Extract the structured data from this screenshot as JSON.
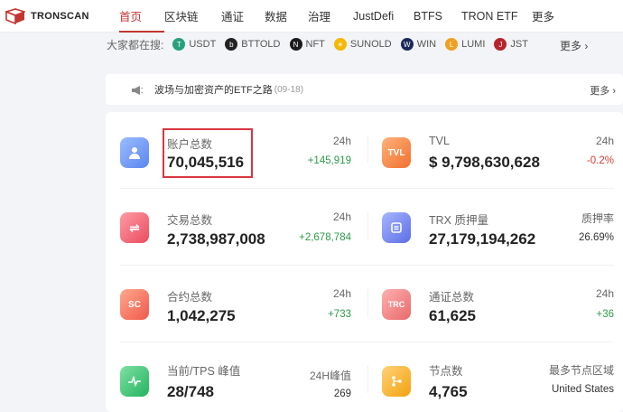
{
  "brand": {
    "name": "TRONSCAN",
    "color": "#c23631"
  },
  "nav": {
    "items": [
      {
        "label": "首页",
        "active": true
      },
      {
        "label": "区块链",
        "active": false
      },
      {
        "label": "通证",
        "active": false
      },
      {
        "label": "数据",
        "active": false
      },
      {
        "label": "治理",
        "active": false
      },
      {
        "label": "JustDefi",
        "active": false
      },
      {
        "label": "BTFS",
        "active": false
      },
      {
        "label": "TRON ETF",
        "active": false
      },
      {
        "label": "更多",
        "active": false
      }
    ]
  },
  "hot_search": {
    "label": "大家都在搜:",
    "tokens": [
      {
        "name": "USDT",
        "icon": "usdt-icon",
        "color": "#26a17b"
      },
      {
        "name": "BTTOLD",
        "icon": "bttold-icon",
        "color": "#222222"
      },
      {
        "name": "NFT",
        "icon": "nft-icon",
        "color": "#1b1b1b"
      },
      {
        "name": "SUNOLD",
        "icon": "sunold-icon",
        "color": "#f5b800"
      },
      {
        "name": "WIN",
        "icon": "win-icon",
        "color": "#1a2a5c"
      },
      {
        "name": "LUMI",
        "icon": "lumi-icon",
        "color": "#f0a020"
      },
      {
        "name": "JST",
        "icon": "jst-icon",
        "color": "#b8242b"
      }
    ],
    "more": "更多 ›"
  },
  "notice": {
    "text": "波场与加密资产的ETF之路",
    "date": "(09-18)",
    "more": "更多 ›"
  },
  "stats": [
    {
      "id": "accounts",
      "label": "账户总数",
      "value": "70,045,516",
      "sub_label": "24h",
      "sub_value": "+145,919",
      "trend": "pos",
      "icon": "accounts-icon",
      "icon_text": "",
      "color": "#6f9cf5"
    },
    {
      "id": "tvl",
      "label": "TVL",
      "value": "$ 9,798,630,628",
      "sub_label": "24h",
      "sub_value": "-0.2%",
      "trend": "neg",
      "icon": "tvl-icon",
      "icon_text": "TVL",
      "color": "#f7924a"
    },
    {
      "id": "transactions",
      "label": "交易总数",
      "value": "2,738,987,008",
      "sub_label": "24h",
      "sub_value": "+2,678,784",
      "trend": "pos",
      "icon": "transactions-icon",
      "icon_text": "⇌",
      "color": "#f26b7a"
    },
    {
      "id": "trx-staked",
      "label": "TRX 质押量",
      "value": "27,179,194,262",
      "sub_label": "质押率",
      "sub_value": "26.69%",
      "trend": "neutral",
      "icon": "staking-icon",
      "icon_text": "",
      "color": "#7a8cf0"
    },
    {
      "id": "contracts",
      "label": "合约总数",
      "value": "1,042,275",
      "sub_label": "24h",
      "sub_value": "+733",
      "trend": "pos",
      "icon": "contracts-icon",
      "icon_text": "SC",
      "color": "#f7826a"
    },
    {
      "id": "tokens",
      "label": "通证总数",
      "value": "61,625",
      "sub_label": "24h",
      "sub_value": "+36",
      "trend": "pos",
      "icon": "tokens-icon",
      "icon_text": "TRC",
      "color": "#f28a8a"
    },
    {
      "id": "tps",
      "label": "当前/TPS 峰值",
      "value": "28/748",
      "sub_label": "24H峰值",
      "sub_value": "269",
      "trend": "neutral",
      "icon": "tps-icon",
      "icon_text": "",
      "color": "#3fc57a"
    },
    {
      "id": "nodes",
      "label": "节点数",
      "value": "4,765",
      "sub_label": "最多节点区域",
      "sub_value": "United States",
      "trend": "neutral",
      "icon": "nodes-icon",
      "icon_text": "",
      "color": "#f7b23a"
    }
  ]
}
